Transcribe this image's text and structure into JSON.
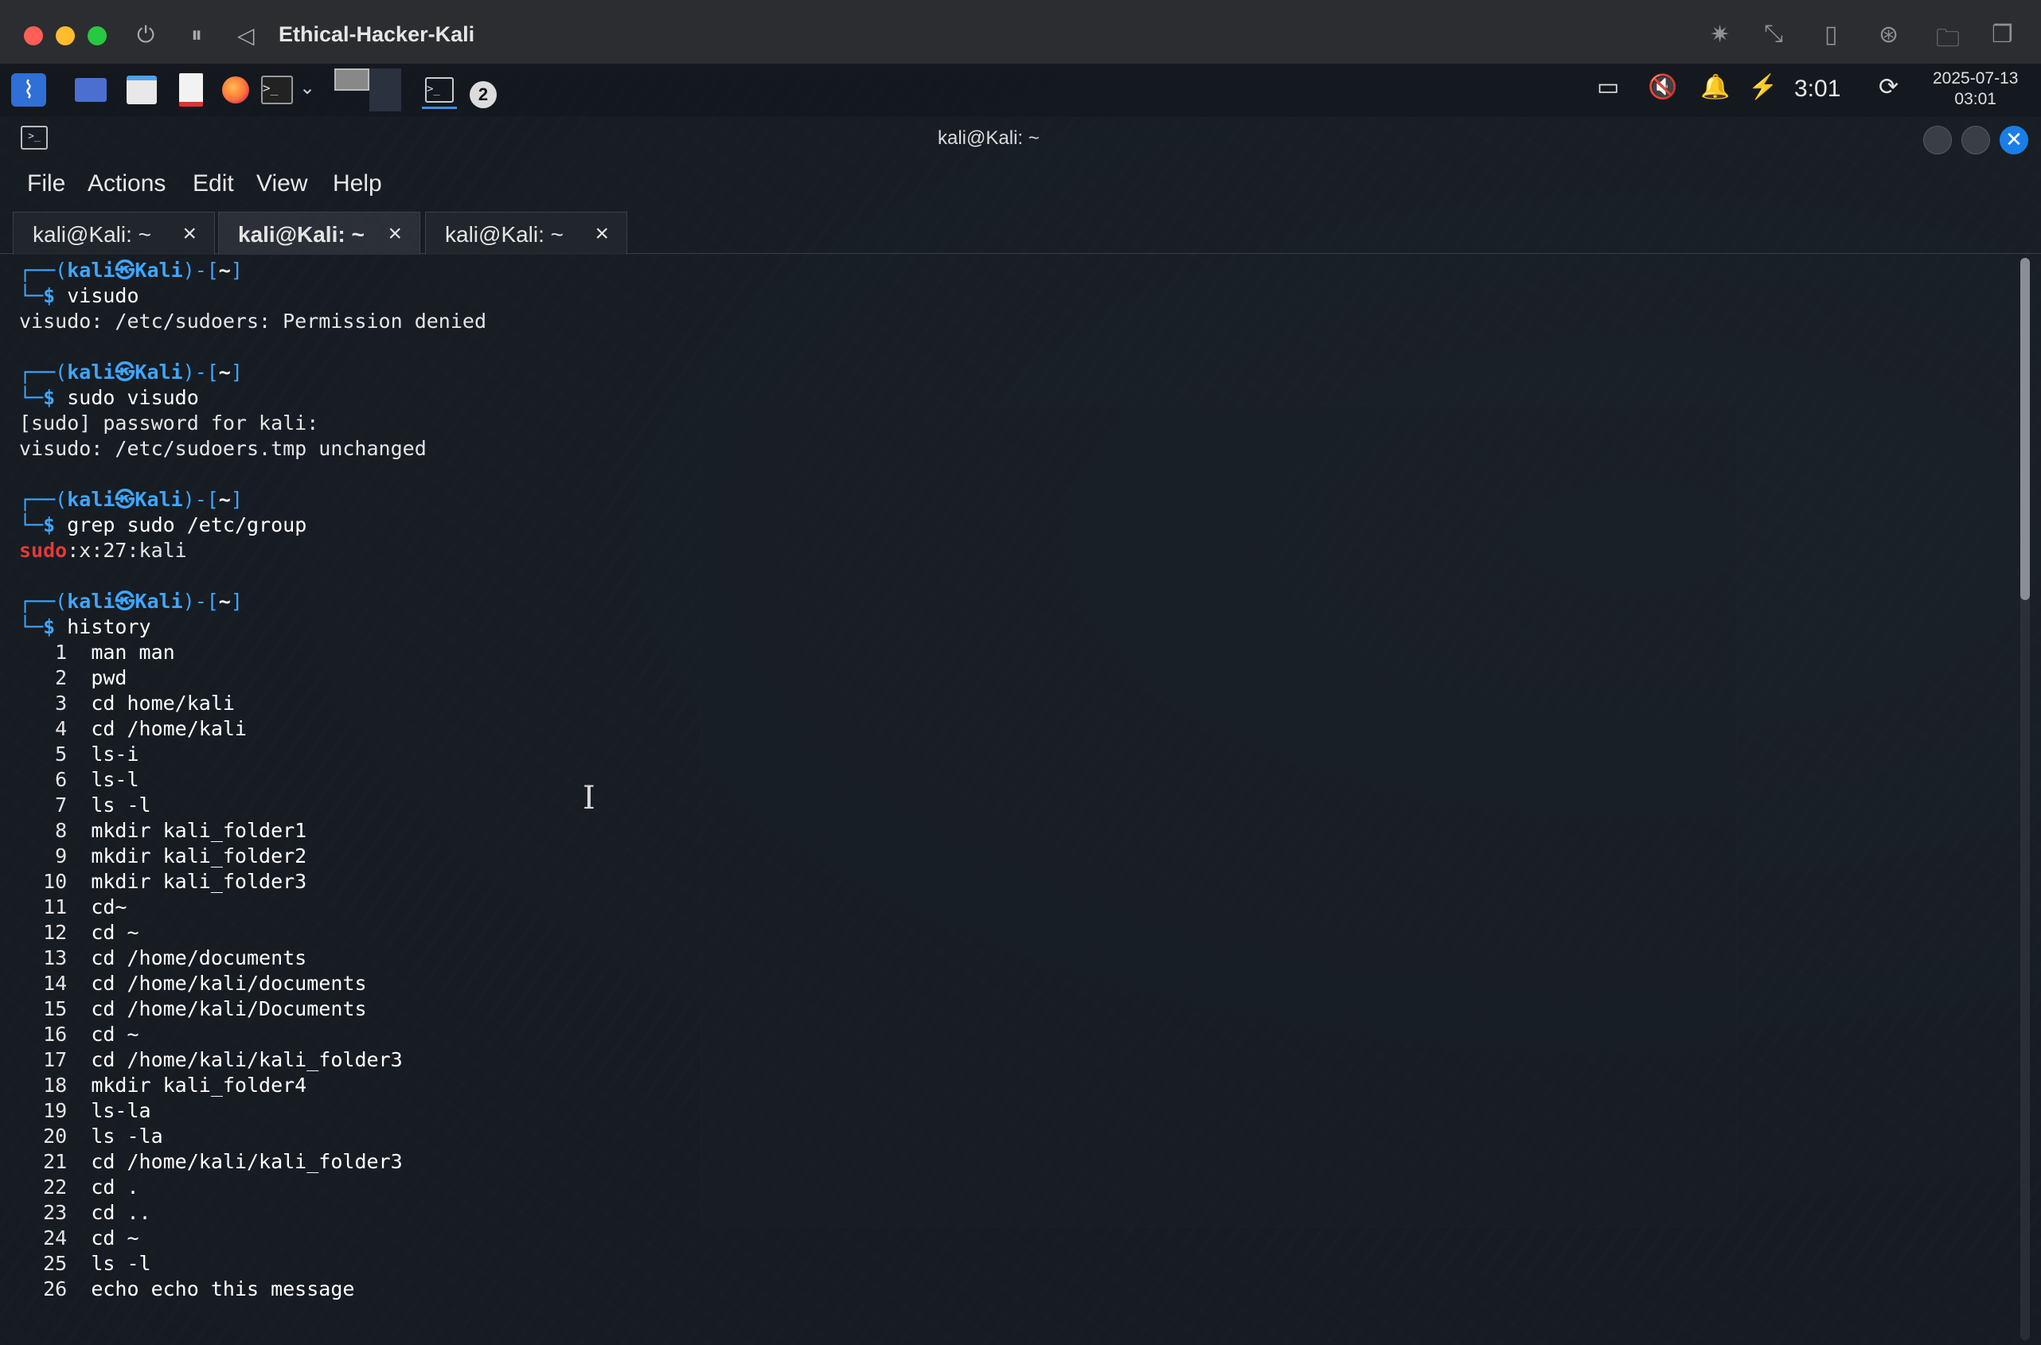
{
  "vm": {
    "title": "Ethical-Hacker-Kali",
    "controls": [
      "power-icon",
      "pause-icon",
      "back-icon"
    ],
    "right_icons": [
      "brightness-icon",
      "resize-icon",
      "usb-icon",
      "network-share-icon",
      "folder-icon",
      "window-icon"
    ]
  },
  "panel": {
    "workspace_badge": "2",
    "clock": "3:01",
    "date": "2025-07-13",
    "time": "03:01"
  },
  "terminal": {
    "title": "kali@Kali: ~",
    "menu": [
      "File",
      "Actions",
      "Edit",
      "View",
      "Help"
    ],
    "tabs": [
      {
        "label": "kali@Kali: ~",
        "close": "×"
      },
      {
        "label": "kali@Kali: ~",
        "close": "×"
      },
      {
        "label": "kali@Kali: ~",
        "close": "×"
      }
    ],
    "active_tab": 1,
    "prompt": {
      "open": "┌──(",
      "user": "kali㉿Kali",
      "mid": ")-[",
      "path": "~",
      "close": "]",
      "second": "└─",
      "dollar": "$"
    },
    "blocks": [
      {
        "command": "visudo",
        "output": [
          "visudo: /etc/sudoers: Permission denied"
        ]
      },
      {
        "command": "sudo visudo",
        "output": [
          "[sudo] password for kali:",
          "visudo: /etc/sudoers.tmp unchanged"
        ]
      },
      {
        "command": "grep sudo /etc/group",
        "output_special": {
          "red": "sudo",
          "rest": ":x:27:kali"
        }
      },
      {
        "command": "history",
        "history": [
          {
            "n": "1",
            "c": "man man"
          },
          {
            "n": "2",
            "c": "pwd"
          },
          {
            "n": "3",
            "c": "cd home/kali"
          },
          {
            "n": "4",
            "c": "cd /home/kali"
          },
          {
            "n": "5",
            "c": "ls-i"
          },
          {
            "n": "6",
            "c": "ls-l"
          },
          {
            "n": "7",
            "c": "ls -l"
          },
          {
            "n": "8",
            "c": "mkdir kali_folder1"
          },
          {
            "n": "9",
            "c": "mkdir kali_folder2"
          },
          {
            "n": "10",
            "c": "mkdir kali_folder3"
          },
          {
            "n": "11",
            "c": "cd~"
          },
          {
            "n": "12",
            "c": "cd ~"
          },
          {
            "n": "13",
            "c": "cd /home/documents"
          },
          {
            "n": "14",
            "c": "cd /home/kali/documents"
          },
          {
            "n": "15",
            "c": "cd /home/kali/Documents"
          },
          {
            "n": "16",
            "c": "cd ~"
          },
          {
            "n": "17",
            "c": "cd /home/kali/kali_folder3"
          },
          {
            "n": "18",
            "c": "mkdir kali_folder4"
          },
          {
            "n": "19",
            "c": "ls-la"
          },
          {
            "n": "20",
            "c": "ls -la"
          },
          {
            "n": "21",
            "c": "cd /home/kali/kali_folder3"
          },
          {
            "n": "22",
            "c": "cd ."
          },
          {
            "n": "23",
            "c": "cd .."
          },
          {
            "n": "24",
            "c": "cd ~"
          },
          {
            "n": "25",
            "c": "ls -l"
          },
          {
            "n": "26",
            "c": "echo echo this message"
          }
        ]
      }
    ]
  },
  "colors": {
    "prompt_blue": "#3fa6ff",
    "error_red": "#e33a3a",
    "close_blue": "#1a7ee6"
  }
}
